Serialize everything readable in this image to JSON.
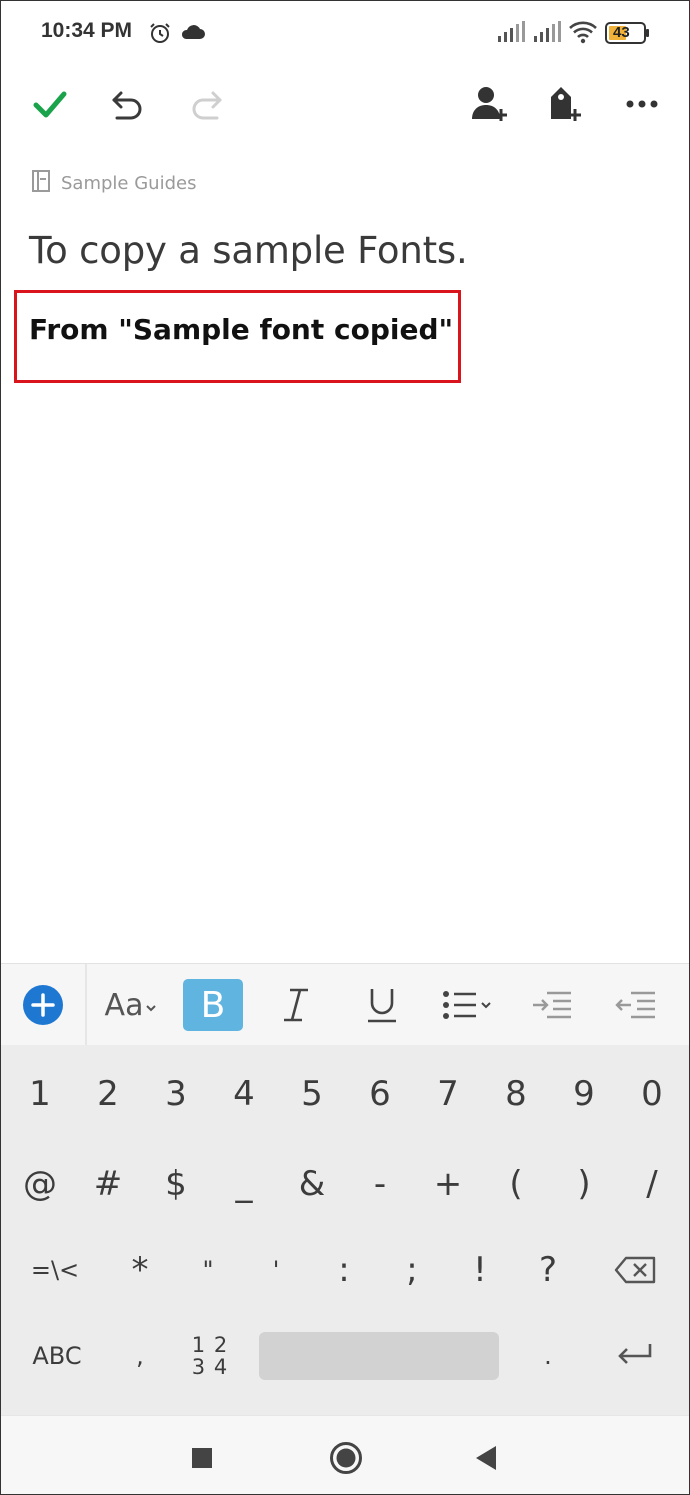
{
  "status_bar": {
    "time": "10:34 PM",
    "battery_level": "43",
    "icons": [
      "alarm-icon",
      "cloud-icon",
      "signal-icon",
      "signal-icon",
      "wifi-icon",
      "battery-icon"
    ]
  },
  "toolbar": {
    "icons": [
      "checkmark-icon",
      "undo-icon",
      "redo-icon",
      "add-user-icon",
      "add-tag-icon",
      "more-icon"
    ],
    "colors": {
      "check": "#1aa34a",
      "icon": "#3a3a3a",
      "disabled": "#cfcfcf"
    }
  },
  "note": {
    "notebook": "Sample Guides",
    "title": "To copy a sample Fonts.",
    "body": "From \"Sample font copied\""
  },
  "highlight_color": "#d9141c",
  "format_bar": {
    "items": [
      "add-icon",
      "font-size-icon",
      "bold-icon",
      "italic-icon",
      "underline-icon",
      "bullet-list-icon",
      "indent-icon",
      "outdent-icon"
    ],
    "font_label": "Aa",
    "bold_label": "B",
    "italic_label": "I",
    "underline_label": "U",
    "accent_color": "#1e78d2",
    "active_bg": "#5fb4e0"
  },
  "keyboard": {
    "row1": [
      "1",
      "2",
      "3",
      "4",
      "5",
      "6",
      "7",
      "8",
      "9",
      "0"
    ],
    "row2": [
      "@",
      "#",
      "$",
      "_",
      "&",
      "-",
      "+",
      "(",
      ")",
      "/"
    ],
    "row3": [
      "=\\<",
      "*",
      "\"",
      "'",
      ":",
      ";",
      "!",
      "?"
    ],
    "row4": {
      "abc": "ABC",
      "comma": ",",
      "num_top": "1 2",
      "num_bottom": "3 4",
      "period": "."
    }
  },
  "nav_bar": {
    "icons": [
      "recents-icon",
      "home-icon",
      "back-icon"
    ]
  }
}
